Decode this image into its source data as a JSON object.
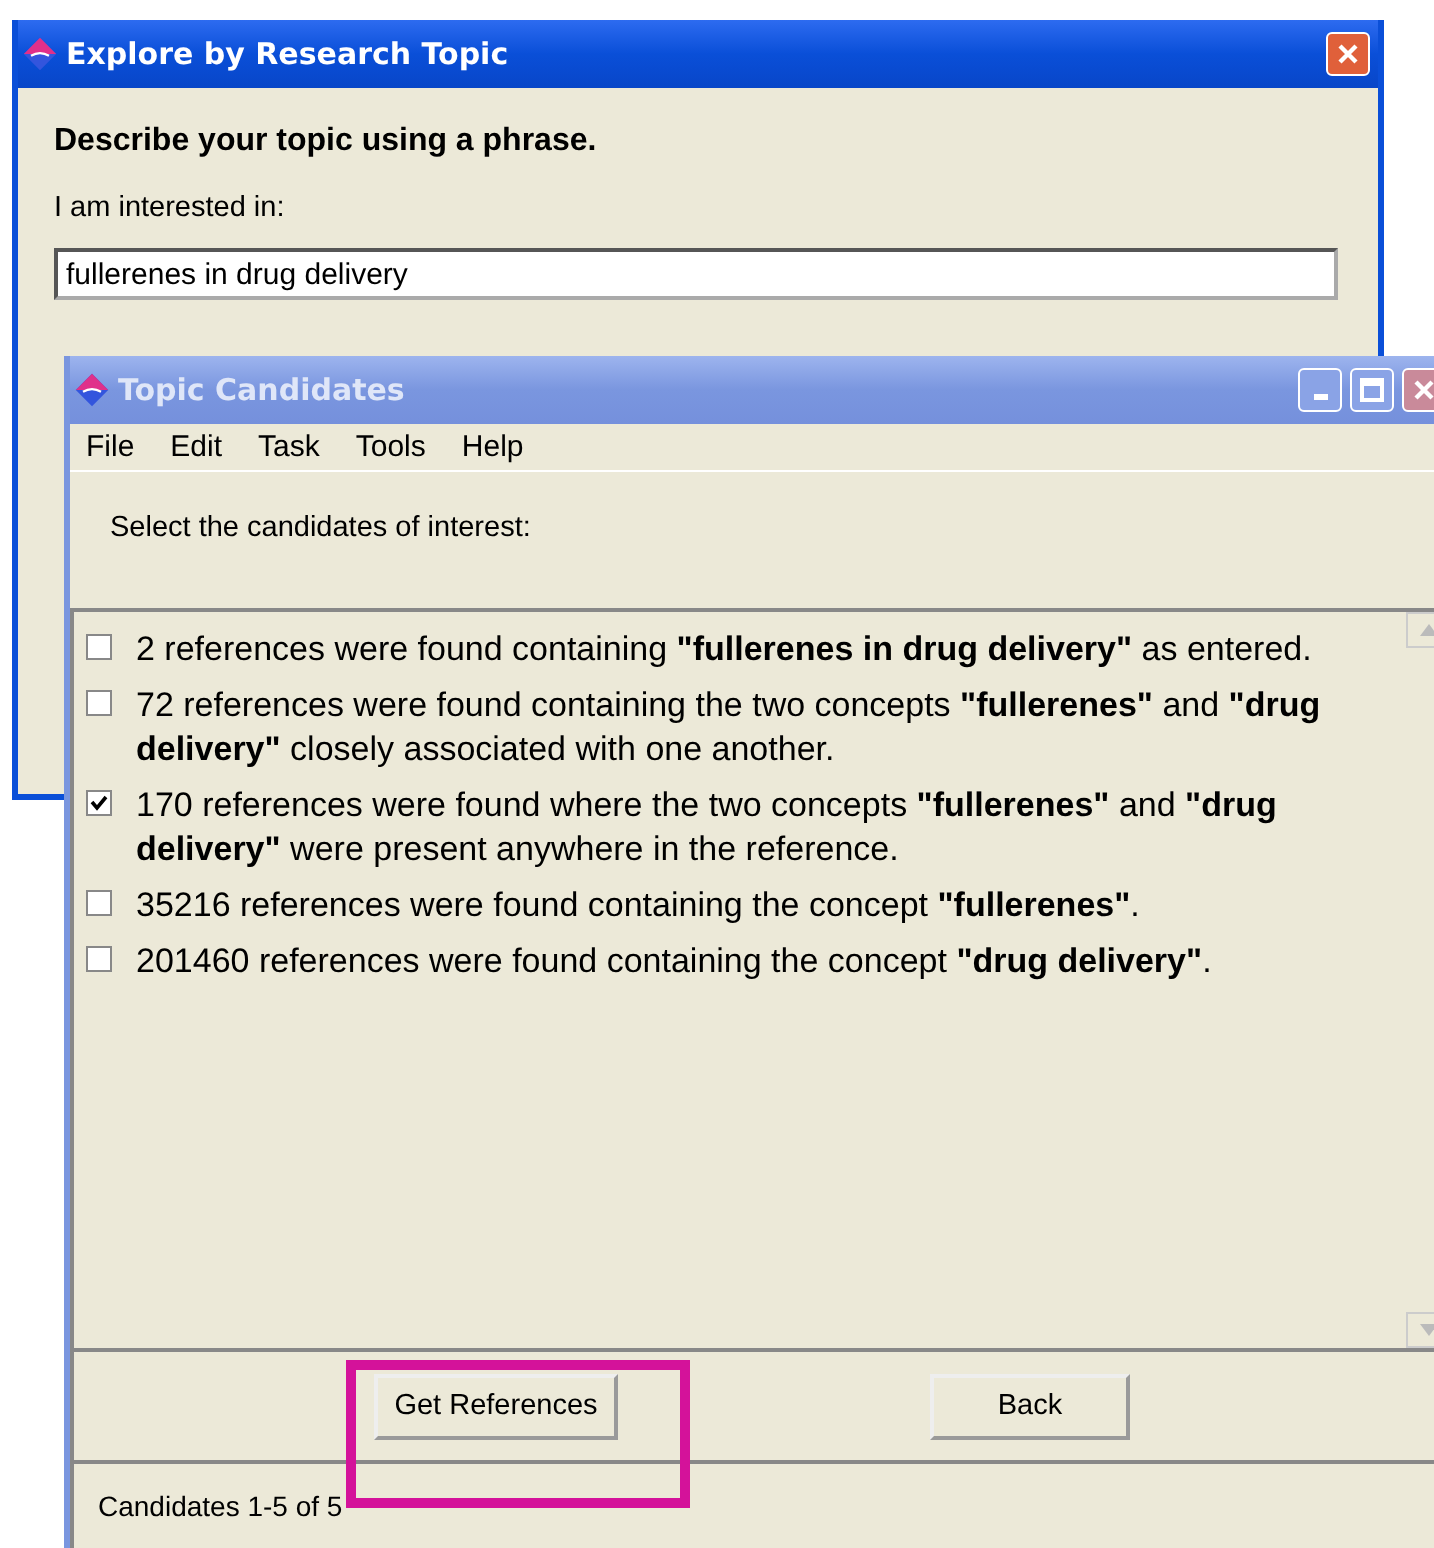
{
  "back_window": {
    "title": "Explore by Research Topic",
    "heading": "Describe your topic using a phrase.",
    "field_label": "I am interested in:",
    "field_value": "fullerenes in drug delivery"
  },
  "front_window": {
    "title": "Topic Candidates",
    "active": false,
    "menu": [
      "File",
      "Edit",
      "Task",
      "Tools",
      "Help"
    ],
    "prompt": "Select the candidates of interest:",
    "candidates": [
      {
        "text": "2 references were found containing **\"fullerenes in drug delivery\"** as entered.",
        "checked": false
      },
      {
        "text": "72 references were found containing the two concepts **\"fullerenes\"** and **\"drug delivery\"** closely associated with one another.",
        "checked": false
      },
      {
        "text": "170 references were found where the two concepts **\"fullerenes\"** and **\"drug delivery\"** were present anywhere in the reference.",
        "checked": true
      },
      {
        "text": "35216 references were found containing the concept **\"fullerenes\"**.",
        "checked": false
      },
      {
        "text": "201460 references were found containing the concept **\"drug delivery\"**.",
        "checked": false
      }
    ],
    "buttons": [
      "Get References",
      "Back"
    ],
    "status": "Candidates 1-5 of 5"
  }
}
